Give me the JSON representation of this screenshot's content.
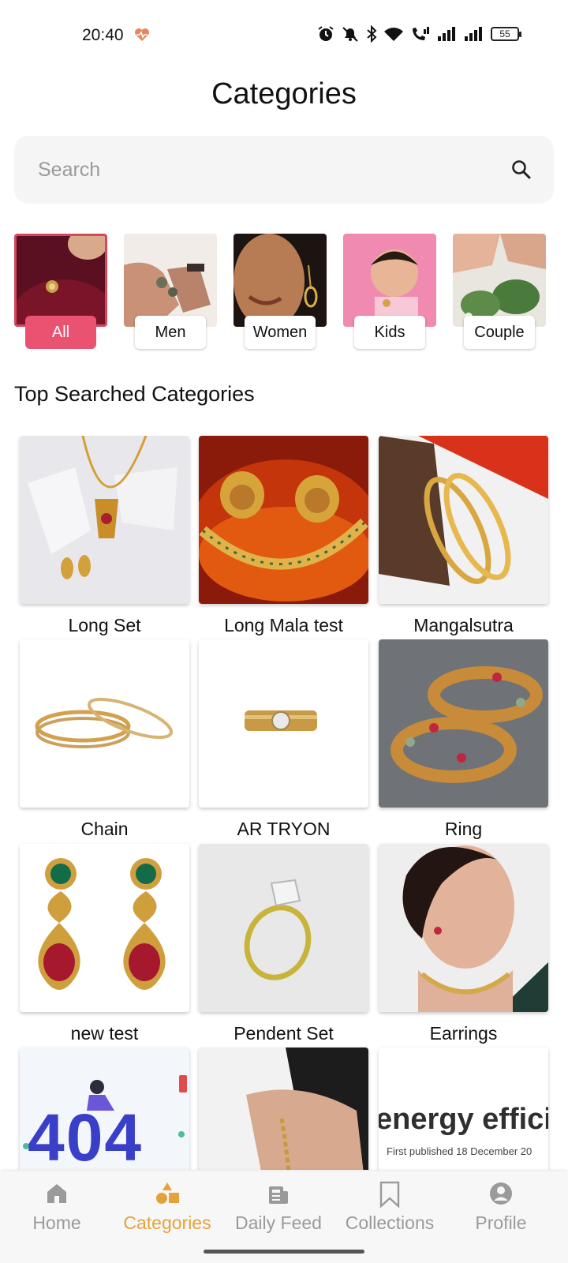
{
  "status_bar": {
    "time": "20:40",
    "battery": "55",
    "icons": [
      "heart-pulse-icon",
      "alarm-icon",
      "mute-icon",
      "bluetooth-icon",
      "wifi-icon",
      "wifi-call-icon",
      "signal-icon",
      "signal-icon"
    ]
  },
  "page": {
    "title": "Categories"
  },
  "search": {
    "placeholder": "Search",
    "value": ""
  },
  "filters": [
    {
      "label": "All",
      "active": true
    },
    {
      "label": "Men",
      "active": false
    },
    {
      "label": "Women",
      "active": false
    },
    {
      "label": "Kids",
      "active": false
    },
    {
      "label": "Couple",
      "active": false
    }
  ],
  "section": {
    "title": "Top Searched Categories"
  },
  "categories": [
    {
      "label": "Long Set"
    },
    {
      "label": "Long Mala test"
    },
    {
      "label": "Mangalsutra"
    },
    {
      "label": "Chain"
    },
    {
      "label": "AR TRYON"
    },
    {
      "label": "Ring"
    },
    {
      "label": "new test"
    },
    {
      "label": "Pendent Set"
    },
    {
      "label": "Earrings"
    },
    {
      "label": "",
      "image_text": "404"
    },
    {
      "label": ""
    },
    {
      "label": "",
      "image_text": "energy effici",
      "image_subtext": "First published 18 December 20"
    }
  ],
  "bottom_nav": [
    {
      "label": "Home",
      "icon": "home-icon",
      "active": false
    },
    {
      "label": "Categories",
      "icon": "categories-icon",
      "active": true
    },
    {
      "label": "Daily Feed",
      "icon": "feed-icon",
      "active": false
    },
    {
      "label": "Collections",
      "icon": "bookmark-icon",
      "active": false
    },
    {
      "label": "Profile",
      "icon": "profile-icon",
      "active": false
    }
  ],
  "colors": {
    "accent": "#e5a23a",
    "chip_active": "#e95270",
    "inactive": "#9a9a9a"
  }
}
